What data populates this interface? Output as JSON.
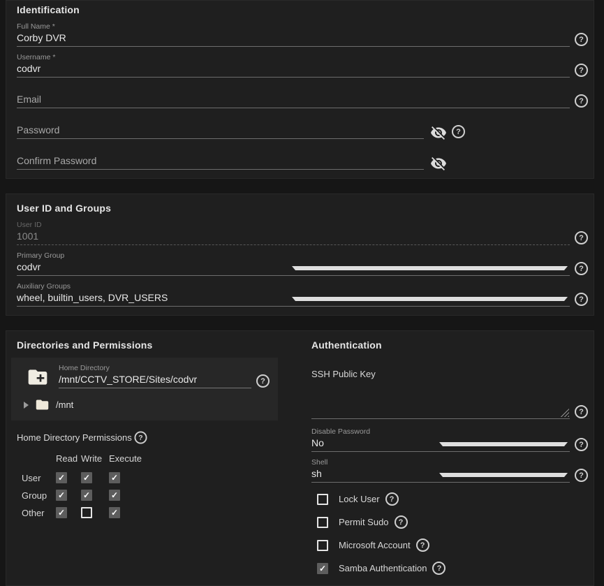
{
  "theme": {
    "page_bg": "#161616",
    "card_bg": "#1f1f1f",
    "panel_bg": "#272727",
    "text": "#e9e9e9",
    "muted_label": "#9a9a9a",
    "underline": "#6d6d6d"
  },
  "identification": {
    "title": "Identification",
    "full_name_label": "Full Name *",
    "full_name_value": "Corby DVR",
    "username_label": "Username *",
    "username_value": "codvr",
    "email_label": "Email",
    "email_value": "",
    "password_label": "Password",
    "confirm_password_label": "Confirm Password"
  },
  "user_id_groups": {
    "title": "User ID and Groups",
    "user_id_label": "User ID",
    "user_id_value": "1001",
    "primary_group_label": "Primary Group",
    "primary_group_value": "codvr",
    "auxiliary_groups_label": "Auxiliary Groups",
    "auxiliary_groups_value": "wheel, builtin_users, DVR_USERS"
  },
  "directories": {
    "title": "Directories and Permissions",
    "home_directory_label": "Home Directory",
    "home_directory_value": "/mnt/CCTV_STORE/Sites/codvr",
    "tree_root": "/mnt",
    "permissions_label": "Home Directory Permissions",
    "columns": [
      "Read",
      "Write",
      "Execute"
    ],
    "rows": [
      {
        "name": "User",
        "read": true,
        "write": true,
        "execute": true
      },
      {
        "name": "Group",
        "read": true,
        "write": true,
        "execute": true
      },
      {
        "name": "Other",
        "read": true,
        "write": false,
        "execute": true
      }
    ]
  },
  "authentication": {
    "title": "Authentication",
    "ssh_public_key_label": "SSH Public Key",
    "ssh_public_key_value": "",
    "disable_password_label": "Disable Password",
    "disable_password_value": "No",
    "shell_label": "Shell",
    "shell_value": "sh",
    "options": [
      {
        "label": "Lock User",
        "checked": false
      },
      {
        "label": "Permit Sudo",
        "checked": false
      },
      {
        "label": "Microsoft Account",
        "checked": false
      },
      {
        "label": "Samba Authentication",
        "checked": true
      }
    ]
  }
}
